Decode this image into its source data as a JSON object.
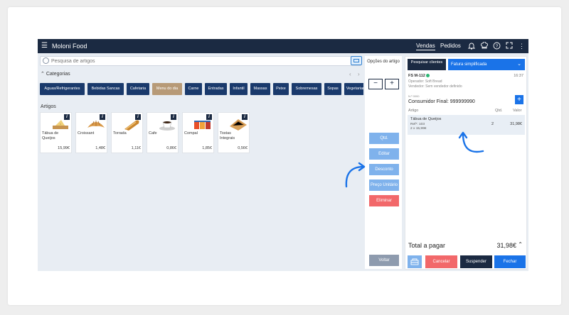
{
  "topbar": {
    "app_title": "Moloni Food",
    "nav_vendas": "Vendas",
    "nav_pedidos": "Pedidos",
    "icons": [
      "bell-icon",
      "chef-hat-icon",
      "help-icon",
      "fullscreen-icon",
      "more-vertical-icon"
    ]
  },
  "search": {
    "placeholder": "Pesquisa de artigos"
  },
  "categories": {
    "label": "Categorias",
    "items": [
      "Aguas/Refrigerantes",
      "Bebidas Sancas",
      "Cafetaria",
      "Menu do dia",
      "Carne",
      "Entradas",
      "Infantil",
      "Massas",
      "Peixe",
      "Sobremesas",
      "Sopas",
      "Vegetariano"
    ]
  },
  "products": {
    "label": "Artigos",
    "items": [
      {
        "name": "Tábua de Queijos",
        "price": "15,99€",
        "icon": "cheese-board-icon"
      },
      {
        "name": "Croissant",
        "price": "1,48€",
        "icon": "croissant-icon"
      },
      {
        "name": "Torrada",
        "price": "1,11€",
        "icon": "toast-icon"
      },
      {
        "name": "Cafe",
        "price": "0,86€",
        "icon": "coffee-icon"
      },
      {
        "name": "Compal",
        "price": "1,85€",
        "icon": "juice-icon"
      },
      {
        "name": "Tostas Integrais",
        "price": "0,56€",
        "icon": "tosta-icon"
      }
    ]
  },
  "options": {
    "title": "Opções do artigo",
    "minus": "−",
    "plus": "+",
    "qtd": "Qtd.",
    "editar": "Editar",
    "desconto": "Desconto",
    "preco": "Preço Unitário",
    "eliminar": "Eliminar",
    "voltar": "Voltar"
  },
  "doc": {
    "search_client": "Pesquisar clientes",
    "doc_type": "Fatura simplificada",
    "doc_id": "FS M-112",
    "time": "16:37",
    "operator": "Operador: Soft Bread",
    "seller": "Vendedor: Sem vendedor definido",
    "nif_label": "N.º 0000",
    "client": "Consumidor Final: 999999990",
    "col_artigo": "Artigo",
    "col_qtd": "Qtd.",
    "col_valor": "Valor",
    "line_name": "Tábua de Queijos",
    "line_ref": "Ref*: 103",
    "line_unit": "2 x 15,99€",
    "line_qty": "2",
    "line_value": "31,98€",
    "total_label": "Total a pagar",
    "total_value": "31,98€",
    "btn_cancel": "Cancelar",
    "btn_suspend": "Suspender",
    "btn_close": "Fechar"
  },
  "colors": {
    "navy": "#1b2a42",
    "blue": "#1a73e8",
    "light_blue": "#7fb2ec",
    "red": "#f2686a"
  }
}
